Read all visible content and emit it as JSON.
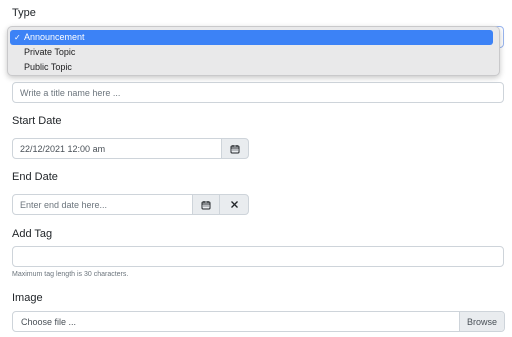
{
  "type_field": {
    "label": "Type",
    "options": [
      "Announcement",
      "Private Topic",
      "Public Topic"
    ],
    "selected": "Announcement"
  },
  "title_field": {
    "placeholder": "Write a title name here ..."
  },
  "start_date": {
    "label": "Start Date",
    "value": "22/12/2021 12:00 am"
  },
  "end_date": {
    "label": "End Date",
    "placeholder": "Enter end date here..."
  },
  "tag": {
    "label": "Add Tag",
    "hint": "Maximum tag length is 30 characters."
  },
  "image": {
    "label": "Image",
    "file_text": "Choose file ...",
    "browse_label": "Browse"
  },
  "colors": {
    "selected_option": "#3c82f6",
    "border": "#ced4da",
    "addon": "#e9ecef"
  }
}
